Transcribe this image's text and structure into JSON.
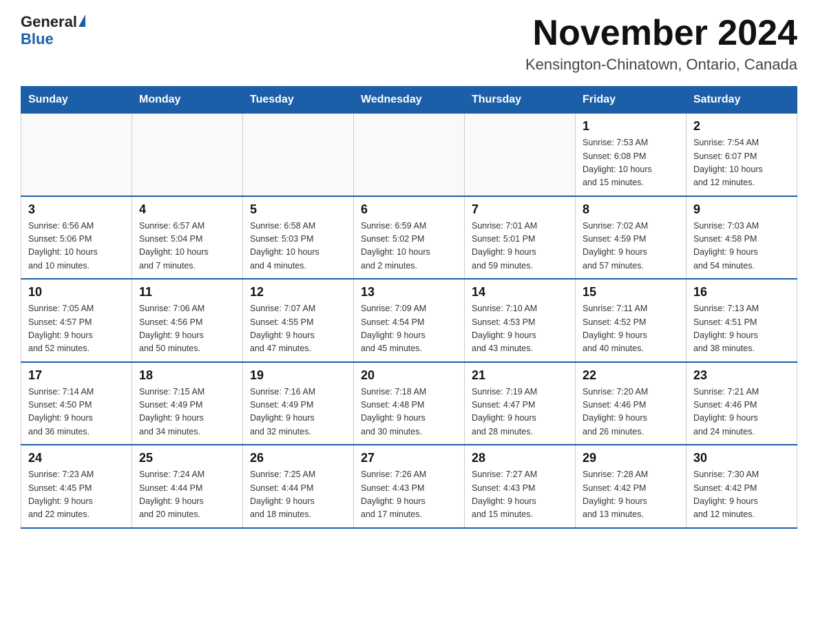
{
  "header": {
    "logo_general": "General",
    "logo_blue": "Blue",
    "month_title": "November 2024",
    "location": "Kensington-Chinatown, Ontario, Canada"
  },
  "weekdays": [
    "Sunday",
    "Monday",
    "Tuesday",
    "Wednesday",
    "Thursday",
    "Friday",
    "Saturday"
  ],
  "weeks": [
    [
      {
        "day": "",
        "info": ""
      },
      {
        "day": "",
        "info": ""
      },
      {
        "day": "",
        "info": ""
      },
      {
        "day": "",
        "info": ""
      },
      {
        "day": "",
        "info": ""
      },
      {
        "day": "1",
        "info": "Sunrise: 7:53 AM\nSunset: 6:08 PM\nDaylight: 10 hours\nand 15 minutes."
      },
      {
        "day": "2",
        "info": "Sunrise: 7:54 AM\nSunset: 6:07 PM\nDaylight: 10 hours\nand 12 minutes."
      }
    ],
    [
      {
        "day": "3",
        "info": "Sunrise: 6:56 AM\nSunset: 5:06 PM\nDaylight: 10 hours\nand 10 minutes."
      },
      {
        "day": "4",
        "info": "Sunrise: 6:57 AM\nSunset: 5:04 PM\nDaylight: 10 hours\nand 7 minutes."
      },
      {
        "day": "5",
        "info": "Sunrise: 6:58 AM\nSunset: 5:03 PM\nDaylight: 10 hours\nand 4 minutes."
      },
      {
        "day": "6",
        "info": "Sunrise: 6:59 AM\nSunset: 5:02 PM\nDaylight: 10 hours\nand 2 minutes."
      },
      {
        "day": "7",
        "info": "Sunrise: 7:01 AM\nSunset: 5:01 PM\nDaylight: 9 hours\nand 59 minutes."
      },
      {
        "day": "8",
        "info": "Sunrise: 7:02 AM\nSunset: 4:59 PM\nDaylight: 9 hours\nand 57 minutes."
      },
      {
        "day": "9",
        "info": "Sunrise: 7:03 AM\nSunset: 4:58 PM\nDaylight: 9 hours\nand 54 minutes."
      }
    ],
    [
      {
        "day": "10",
        "info": "Sunrise: 7:05 AM\nSunset: 4:57 PM\nDaylight: 9 hours\nand 52 minutes."
      },
      {
        "day": "11",
        "info": "Sunrise: 7:06 AM\nSunset: 4:56 PM\nDaylight: 9 hours\nand 50 minutes."
      },
      {
        "day": "12",
        "info": "Sunrise: 7:07 AM\nSunset: 4:55 PM\nDaylight: 9 hours\nand 47 minutes."
      },
      {
        "day": "13",
        "info": "Sunrise: 7:09 AM\nSunset: 4:54 PM\nDaylight: 9 hours\nand 45 minutes."
      },
      {
        "day": "14",
        "info": "Sunrise: 7:10 AM\nSunset: 4:53 PM\nDaylight: 9 hours\nand 43 minutes."
      },
      {
        "day": "15",
        "info": "Sunrise: 7:11 AM\nSunset: 4:52 PM\nDaylight: 9 hours\nand 40 minutes."
      },
      {
        "day": "16",
        "info": "Sunrise: 7:13 AM\nSunset: 4:51 PM\nDaylight: 9 hours\nand 38 minutes."
      }
    ],
    [
      {
        "day": "17",
        "info": "Sunrise: 7:14 AM\nSunset: 4:50 PM\nDaylight: 9 hours\nand 36 minutes."
      },
      {
        "day": "18",
        "info": "Sunrise: 7:15 AM\nSunset: 4:49 PM\nDaylight: 9 hours\nand 34 minutes."
      },
      {
        "day": "19",
        "info": "Sunrise: 7:16 AM\nSunset: 4:49 PM\nDaylight: 9 hours\nand 32 minutes."
      },
      {
        "day": "20",
        "info": "Sunrise: 7:18 AM\nSunset: 4:48 PM\nDaylight: 9 hours\nand 30 minutes."
      },
      {
        "day": "21",
        "info": "Sunrise: 7:19 AM\nSunset: 4:47 PM\nDaylight: 9 hours\nand 28 minutes."
      },
      {
        "day": "22",
        "info": "Sunrise: 7:20 AM\nSunset: 4:46 PM\nDaylight: 9 hours\nand 26 minutes."
      },
      {
        "day": "23",
        "info": "Sunrise: 7:21 AM\nSunset: 4:46 PM\nDaylight: 9 hours\nand 24 minutes."
      }
    ],
    [
      {
        "day": "24",
        "info": "Sunrise: 7:23 AM\nSunset: 4:45 PM\nDaylight: 9 hours\nand 22 minutes."
      },
      {
        "day": "25",
        "info": "Sunrise: 7:24 AM\nSunset: 4:44 PM\nDaylight: 9 hours\nand 20 minutes."
      },
      {
        "day": "26",
        "info": "Sunrise: 7:25 AM\nSunset: 4:44 PM\nDaylight: 9 hours\nand 18 minutes."
      },
      {
        "day": "27",
        "info": "Sunrise: 7:26 AM\nSunset: 4:43 PM\nDaylight: 9 hours\nand 17 minutes."
      },
      {
        "day": "28",
        "info": "Sunrise: 7:27 AM\nSunset: 4:43 PM\nDaylight: 9 hours\nand 15 minutes."
      },
      {
        "day": "29",
        "info": "Sunrise: 7:28 AM\nSunset: 4:42 PM\nDaylight: 9 hours\nand 13 minutes."
      },
      {
        "day": "30",
        "info": "Sunrise: 7:30 AM\nSunset: 4:42 PM\nDaylight: 9 hours\nand 12 minutes."
      }
    ]
  ]
}
